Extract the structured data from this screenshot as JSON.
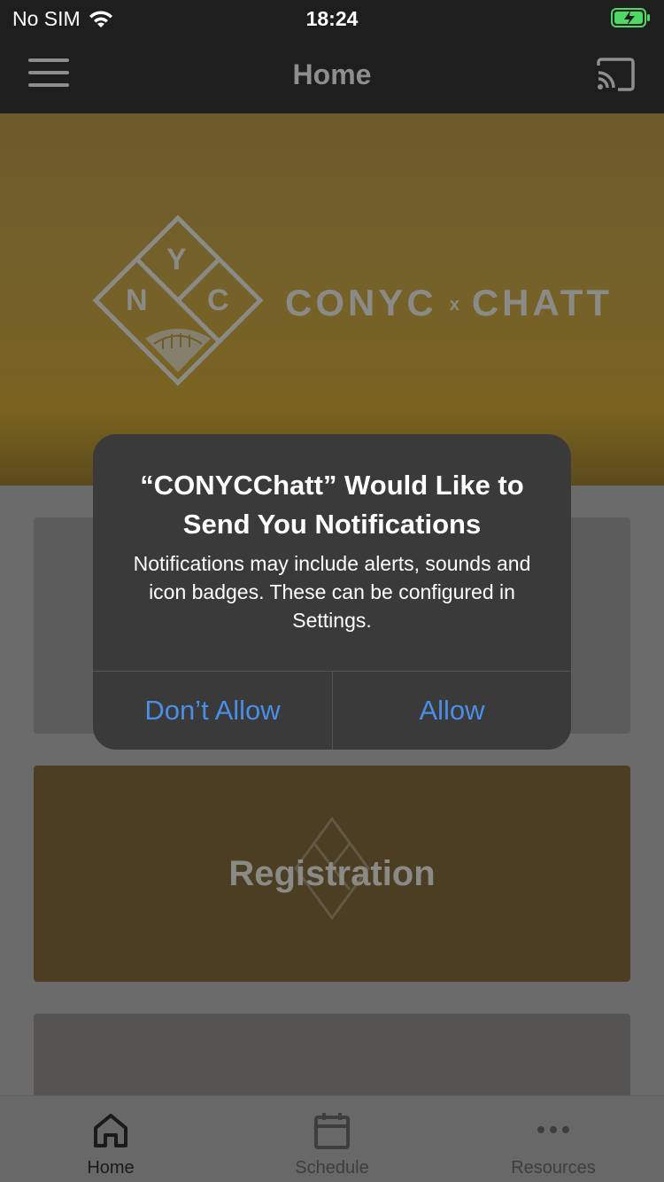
{
  "status_bar": {
    "carrier": "No SIM",
    "time": "18:24"
  },
  "nav": {
    "title": "Home"
  },
  "hero": {
    "logo_letters": [
      "Y",
      "N",
      "C"
    ],
    "brand_left": "CONYC",
    "brand_sep": "x",
    "brand_right": "CHATT"
  },
  "cards": [
    {
      "label": ""
    },
    {
      "label": "Registration"
    },
    {
      "label": ""
    }
  ],
  "tabs": [
    {
      "label": "Home",
      "icon": "home-icon",
      "active": true
    },
    {
      "label": "Schedule",
      "icon": "calendar-icon",
      "active": false
    },
    {
      "label": "Resources",
      "icon": "more-icon",
      "active": false
    }
  ],
  "alert": {
    "title": "“CONYCChatt” Would Like to Send You Notifications",
    "message": "Notifications may include alerts, sounds and icon badges. These can be configured in Settings.",
    "dont_allow_label": "Don’t Allow",
    "allow_label": "Allow"
  },
  "colors": {
    "alert_button": "#4a8ee6",
    "battery_green": "#4cd964",
    "hero_gold": "#75612a",
    "card_gold": "#4c3e22"
  }
}
